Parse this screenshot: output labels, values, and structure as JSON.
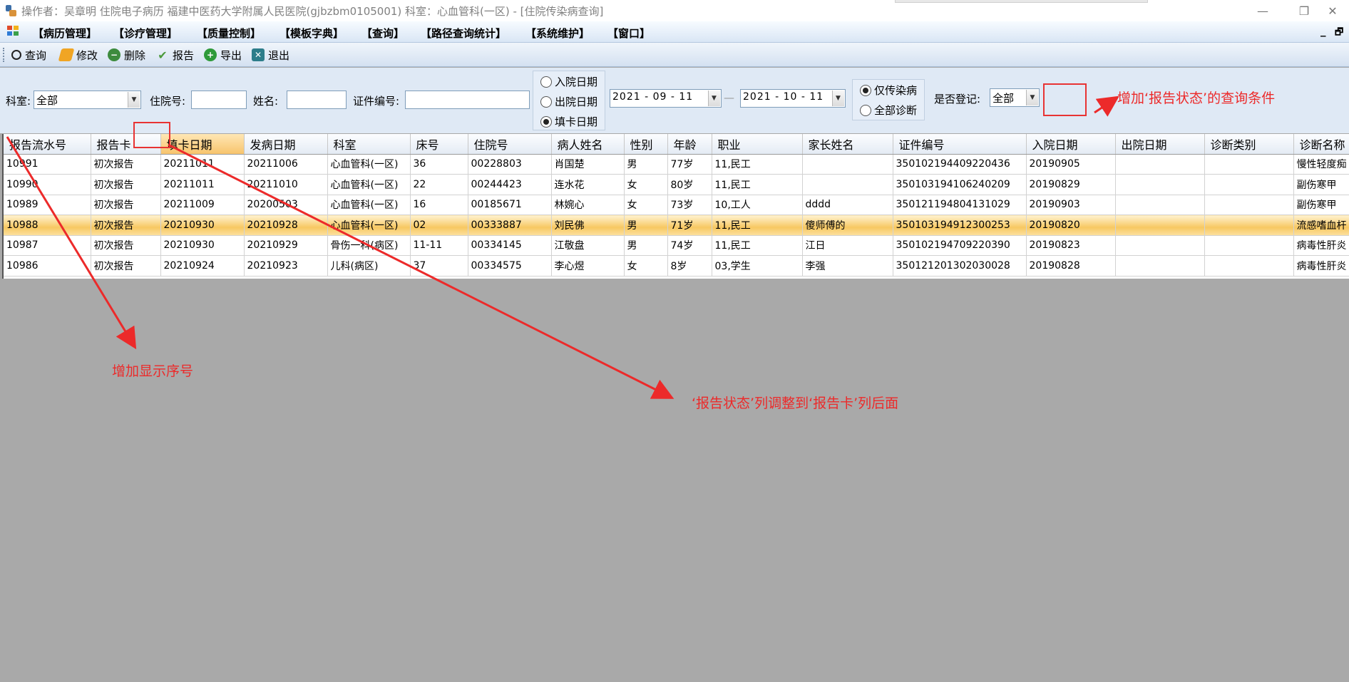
{
  "window": {
    "title": "操作者：吴章明 住院电子病历  福建中医药大学附属人民医院(gjbzbm0105001)  科室：心血管科(一区) - [住院传染病查询]",
    "controls": {
      "minimize": "—",
      "restore": "❐",
      "close": "✕"
    }
  },
  "menu": {
    "items": [
      "【病历管理】",
      "【诊疗管理】",
      "【质量控制】",
      "【模板字典】",
      "【查询】",
      "【路径查询统计】",
      "【系统维护】",
      "【窗口】"
    ],
    "mdi_minimize": "_",
    "mdi_restore": "🗗"
  },
  "toolbar": {
    "buttons": [
      {
        "label": "查询",
        "icon": "magnifier-icon",
        "color": "#2b2b2b"
      },
      {
        "label": "修改",
        "icon": "eraser-icon",
        "color": "#e8a020"
      },
      {
        "label": "删除",
        "icon": "minus-circle-icon",
        "color": "#3a8a3a"
      },
      {
        "label": "报告",
        "icon": "check-icon",
        "color": "#6aa84f"
      },
      {
        "label": "导出",
        "icon": "plus-circle-icon",
        "color": "#2e9a3a"
      },
      {
        "label": "退出",
        "icon": "exit-icon",
        "color": "#2d7d8a"
      }
    ]
  },
  "filters": {
    "dept_label": "科室:",
    "dept_value": "全部",
    "inpatient_no_label": "住院号:",
    "inpatient_no_value": "",
    "name_label": "姓名:",
    "name_value": "",
    "id_no_label": "证件编号:",
    "id_no_value": "",
    "date_type": {
      "options": [
        "入院日期",
        "出院日期",
        "填卡日期"
      ],
      "selected": "填卡日期"
    },
    "date_from": "2021 - 09 - 11",
    "date_sep": "—",
    "date_to": "2021 - 10 - 11",
    "disease_scope": {
      "options": [
        "仅传染病",
        "全部诊断"
      ],
      "selected": "仅传染病"
    },
    "registered_label": "是否登记:",
    "registered_value": "全部"
  },
  "grid": {
    "columns": [
      "报告流水号",
      "报告卡",
      "填卡日期",
      "发病日期",
      "科室",
      "床号",
      "住院号",
      "病人姓名",
      "性别",
      "年龄",
      "职业",
      "家长姓名",
      "证件编号",
      "入院日期",
      "出院日期",
      "诊断类别",
      "诊断名称"
    ],
    "sorted_column": "填卡日期",
    "selected_row": 3,
    "rows": [
      [
        "10991",
        "初次报告",
        "20211011",
        "20211006",
        "心血管科(一区)",
        "36",
        "00228803",
        "肖国楚",
        "男",
        "77岁",
        "11,民工",
        "",
        "350102194409220436",
        "20190905",
        "",
        "",
        "慢性轻度痴"
      ],
      [
        "10990",
        "初次报告",
        "20211011",
        "20211010",
        "心血管科(一区)",
        "22",
        "00244423",
        "连水花",
        "女",
        "80岁",
        "11,民工",
        "",
        "350103194106240209",
        "20190829",
        "",
        "",
        "副伤寒甲"
      ],
      [
        "10989",
        "初次报告",
        "20211009",
        "20200503",
        "心血管科(一区)",
        "16",
        "00185671",
        "林婉心",
        "女",
        "73岁",
        "10,工人",
        "dddd",
        "350121194804131029",
        "20190903",
        "",
        "",
        "副伤寒甲"
      ],
      [
        "10988",
        "初次报告",
        "20210930",
        "20210928",
        "心血管科(一区)",
        "02",
        "00333887",
        "刘民佛",
        "男",
        "71岁",
        "11,民工",
        "傻师傅的",
        "350103194912300253",
        "20190820",
        "",
        "",
        "流感嗜血杆"
      ],
      [
        "10987",
        "初次报告",
        "20210930",
        "20210929",
        "骨伤一科(病区)",
        "11-11",
        "00334145",
        "江敬盘",
        "男",
        "74岁",
        "11,民工",
        "江日",
        "350102194709220390",
        "20190823",
        "",
        "",
        "病毒性肝炎"
      ],
      [
        "10986",
        "初次报告",
        "20210924",
        "20210923",
        "儿科(病区)",
        "37",
        "00334575",
        "李心煜",
        "女",
        "8岁",
        "03,学生",
        "李强",
        "350121201302030028",
        "20190828",
        "",
        "",
        "病毒性肝炎"
      ]
    ]
  },
  "annotations": {
    "color": "#ec2a2a",
    "query_condition": "增加‘报告状态’的查询条件",
    "show_seq": "增加显示序号",
    "move_column": "‘报告状态’列调整到‘报告卡’列后面"
  }
}
